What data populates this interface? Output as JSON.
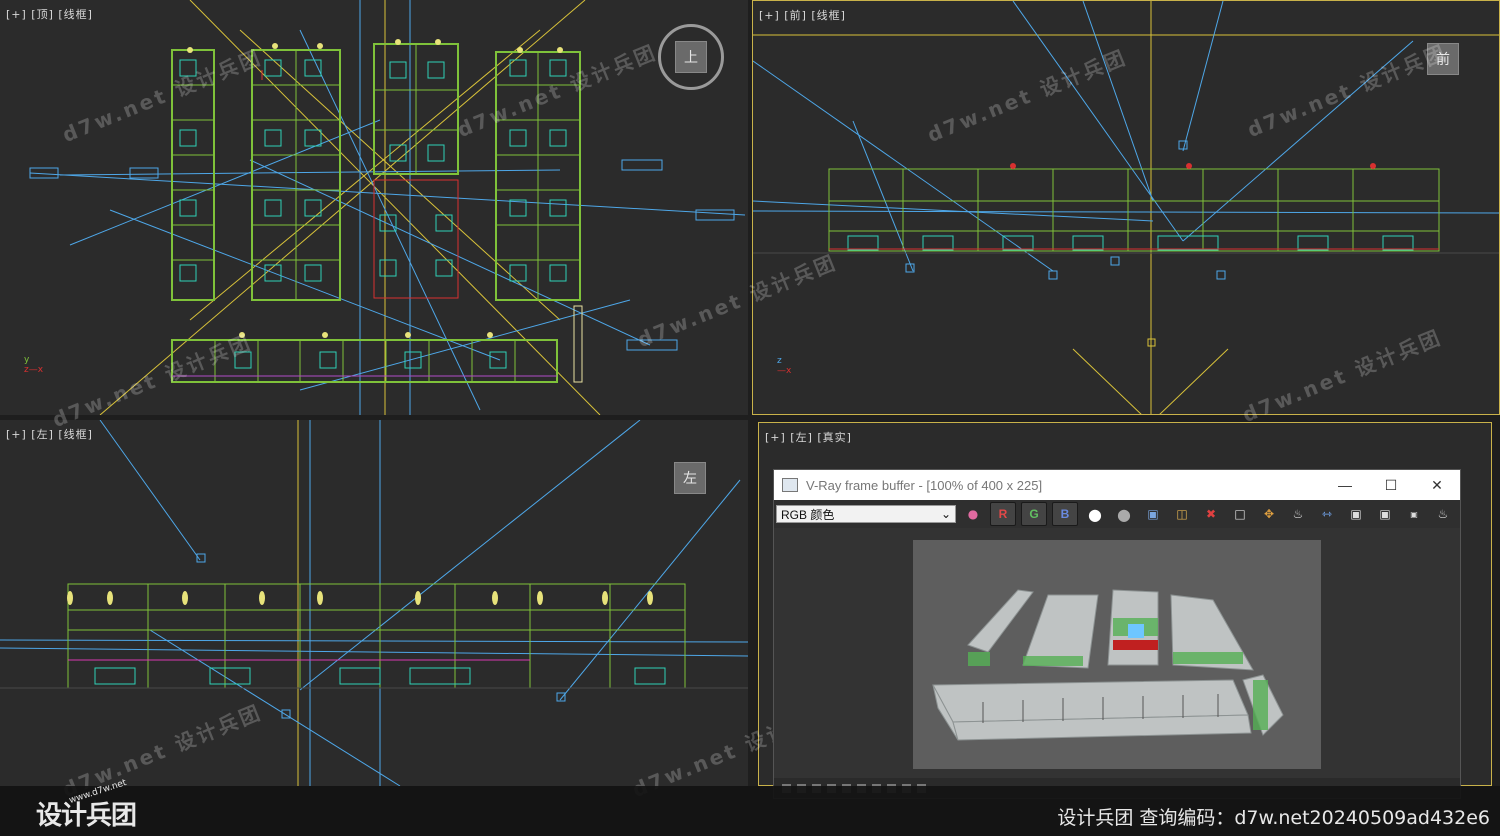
{
  "viewports": {
    "top": {
      "label": "[+] [顶] [线框]",
      "cube": "上"
    },
    "front": {
      "label": "[+] [前] [线框]",
      "cube": "前"
    },
    "left": {
      "label": "[+] [左] [线框]",
      "cube": "左"
    },
    "persp": {
      "label": "[+] [左] [真实]"
    }
  },
  "vfb": {
    "title": "V-Ray frame buffer - [100% of 400 x 225]",
    "channel": "RGB 颜色",
    "r": "R",
    "g": "G",
    "b": "B"
  },
  "watermark": "d7w.net 设计兵团",
  "footer": {
    "logo": "设计兵团",
    "logo_url": "www.d7w.net",
    "text": "设计兵团  查询编码：d7w.net20240509ad432e6"
  },
  "colors": {
    "wire_green": "#7fc23a",
    "wire_blue": "#4ea7e8",
    "wire_yellow": "#d8c23a",
    "wire_cyan": "#2fd1b7",
    "wire_red": "#d83030",
    "active_border": "#c9b24a"
  }
}
